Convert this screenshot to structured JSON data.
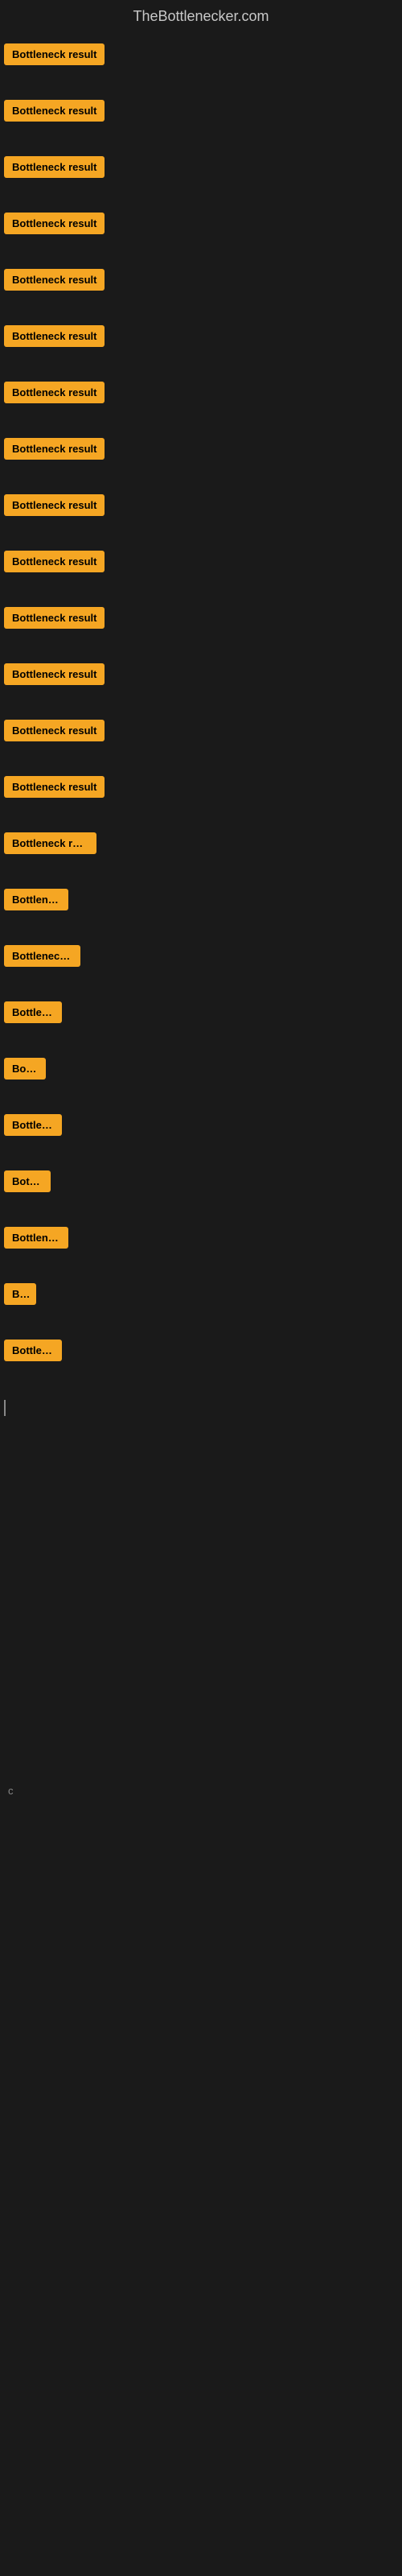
{
  "site": {
    "title": "TheBottlenecker.com"
  },
  "items": [
    {
      "id": 1,
      "label": "Bottleneck result",
      "width": 130
    },
    {
      "id": 2,
      "label": "Bottleneck result",
      "width": 130
    },
    {
      "id": 3,
      "label": "Bottleneck result",
      "width": 130
    },
    {
      "id": 4,
      "label": "Bottleneck result",
      "width": 130
    },
    {
      "id": 5,
      "label": "Bottleneck result",
      "width": 130
    },
    {
      "id": 6,
      "label": "Bottleneck result",
      "width": 130
    },
    {
      "id": 7,
      "label": "Bottleneck result",
      "width": 130
    },
    {
      "id": 8,
      "label": "Bottleneck result",
      "width": 130
    },
    {
      "id": 9,
      "label": "Bottleneck result",
      "width": 130
    },
    {
      "id": 10,
      "label": "Bottleneck result",
      "width": 130
    },
    {
      "id": 11,
      "label": "Bottleneck result",
      "width": 130
    },
    {
      "id": 12,
      "label": "Bottleneck result",
      "width": 130
    },
    {
      "id": 13,
      "label": "Bottleneck result",
      "width": 130
    },
    {
      "id": 14,
      "label": "Bottleneck result",
      "width": 130
    },
    {
      "id": 15,
      "label": "Bottleneck resu",
      "width": 115
    },
    {
      "id": 16,
      "label": "Bottleneck",
      "width": 80
    },
    {
      "id": 17,
      "label": "Bottleneck re",
      "width": 95
    },
    {
      "id": 18,
      "label": "Bottlenec",
      "width": 72
    },
    {
      "id": 19,
      "label": "Bottle",
      "width": 52
    },
    {
      "id": 20,
      "label": "Bottlenec",
      "width": 72
    },
    {
      "id": 21,
      "label": "Bottlen",
      "width": 58
    },
    {
      "id": 22,
      "label": "Bottleneck",
      "width": 80
    },
    {
      "id": 23,
      "label": "Bott",
      "width": 40
    },
    {
      "id": 24,
      "label": "Bottlenec",
      "width": 72
    }
  ],
  "cursor_item_index": 24,
  "small_label": "c",
  "accent_color": "#f5a623"
}
